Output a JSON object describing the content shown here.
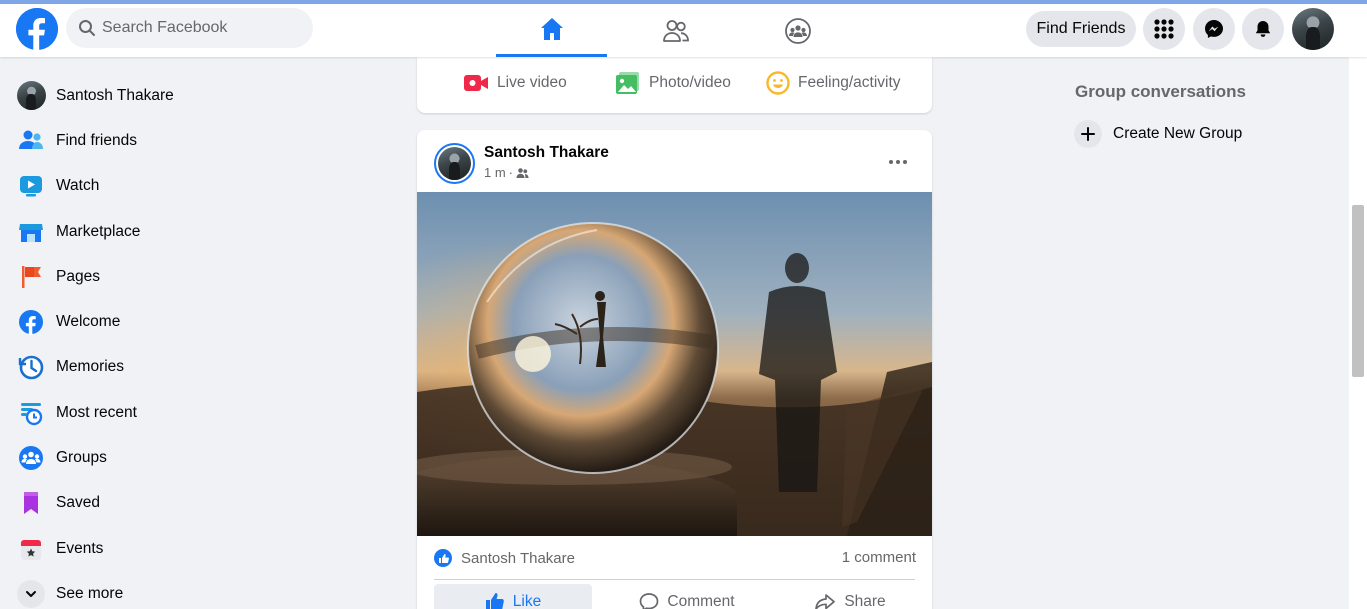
{
  "header": {
    "search_placeholder": "Search Facebook",
    "find_friends_label": "Find Friends",
    "accent_color": "#1877f2",
    "nav_tabs": [
      {
        "name": "home",
        "icon": "home-icon",
        "active": true
      },
      {
        "name": "friends",
        "icon": "friends-icon",
        "active": false
      },
      {
        "name": "groups",
        "icon": "groups-icon",
        "active": false
      }
    ]
  },
  "sidebar": {
    "items": [
      {
        "label": "Santosh Thakare",
        "icon": "profile-avatar"
      },
      {
        "label": "Find friends",
        "icon": "find-friends-icon"
      },
      {
        "label": "Watch",
        "icon": "watch-icon"
      },
      {
        "label": "Marketplace",
        "icon": "marketplace-icon"
      },
      {
        "label": "Pages",
        "icon": "pages-flag-icon"
      },
      {
        "label": "Welcome",
        "icon": "facebook-welcome-icon"
      },
      {
        "label": "Memories",
        "icon": "memories-clock-icon"
      },
      {
        "label": "Most recent",
        "icon": "most-recent-icon"
      },
      {
        "label": "Groups",
        "icon": "groups-icon"
      },
      {
        "label": "Saved",
        "icon": "saved-bookmark-icon"
      },
      {
        "label": "Events",
        "icon": "events-calendar-icon"
      },
      {
        "label": "See more",
        "icon": "chevron-down-icon"
      }
    ]
  },
  "create_post": {
    "live_video_label": "Live video",
    "photo_video_label": "Photo/video",
    "feeling_label": "Feeling/activity"
  },
  "post": {
    "author": "Santosh Thakare",
    "time": "1 m",
    "audience_icon": "friends-audience-icon",
    "reactor": "Santosh Thakare",
    "comment_count": "1 comment",
    "like_label": "Like",
    "comment_label": "Comment",
    "share_label": "Share"
  },
  "right_column": {
    "title": "Group conversations",
    "create_group_label": "Create New Group"
  }
}
